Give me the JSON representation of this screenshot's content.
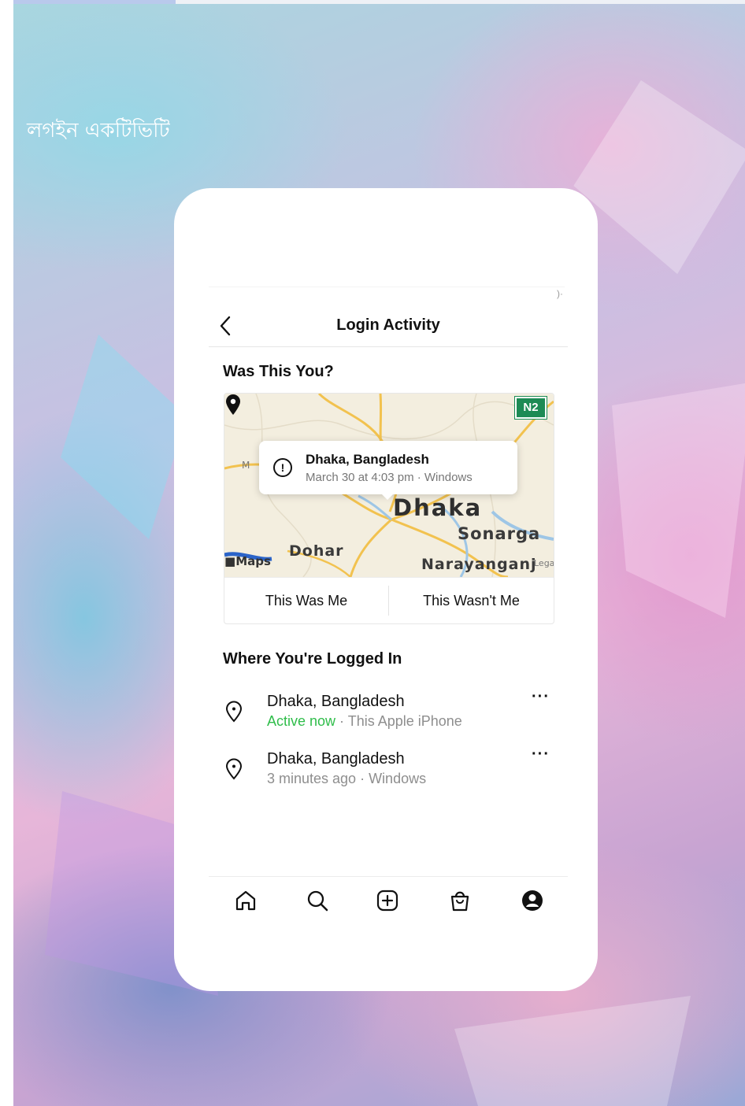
{
  "page": {
    "heading": "লগইন একটিভিটি"
  },
  "header": {
    "title": "Login Activity",
    "back_icon": "chevron-left-icon"
  },
  "suspicious": {
    "section_title": "Was This You?",
    "map": {
      "city_label": "Dhaka",
      "sonargaon_label": "Sonarga",
      "dohar_label": "Dohar",
      "narayanganj_label": "Narayanganj",
      "maps_brand": "Maps",
      "legal_label": "Legal",
      "partial_label": "M",
      "road_badge": "N2",
      "badge_color": "#1d8b55"
    },
    "tooltip": {
      "title": "Dhaka, Bangladesh",
      "subtitle": "March 30 at 4:03 pm · Windows",
      "icon": "alert-circle-icon"
    },
    "confirm_label": "This Was Me",
    "deny_label": "This Wasn't Me"
  },
  "sessions": {
    "section_title": "Where You're Logged In",
    "items": [
      {
        "location": "Dhaka, Bangladesh",
        "status": "Active now",
        "device": " · This Apple iPhone",
        "more": "···"
      },
      {
        "location": "Dhaka, Bangladesh",
        "status": "3 minutes ago · Windows",
        "more": "···"
      }
    ],
    "active_color": "#2fbd4a"
  },
  "tabbar": {
    "items": [
      "home-icon",
      "search-icon",
      "create-icon",
      "shop-icon",
      "profile-icon"
    ]
  }
}
